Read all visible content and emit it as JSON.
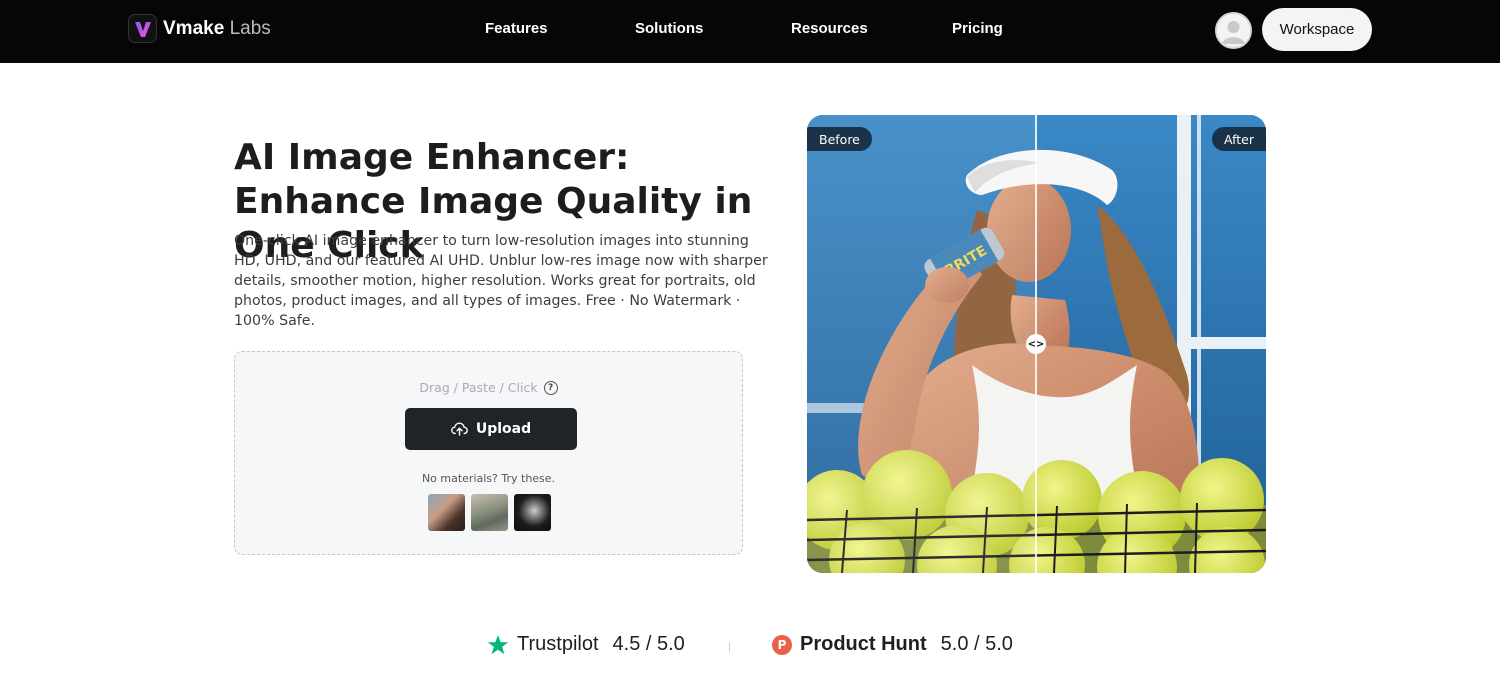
{
  "nav": {
    "logo_brand": "Vmake",
    "logo_suffix": "Labs",
    "links": [
      "Features",
      "Solutions",
      "Resources",
      "Pricing"
    ],
    "workspace_label": "Workspace"
  },
  "hero": {
    "title": "AI Image Enhancer: Enhance Image Quality in One Click",
    "description": "One-click AI image enhancer to turn low-resolution images into stunning HD, UHD, and our featured AI UHD. Unblur low-res image now with sharper details, smoother motion, higher resolution. Works great for portraits, old photos, product images, and all types of images. Free · No Watermark · 100% Safe."
  },
  "upload": {
    "drag_hint": "Drag / Paste / Click",
    "button_label": "Upload",
    "materials_label": "No materials? Try these."
  },
  "compare": {
    "before_label": "Before",
    "after_label": "After",
    "handle_glyph": "<>"
  },
  "ratings": [
    {
      "name": "Trustpilot",
      "score": "4.5 / 5.0"
    },
    {
      "name": "Product Hunt",
      "score": "5.0 / 5.0",
      "icon_letter": "P"
    }
  ],
  "colors": {
    "nav_bg": "#060606",
    "upload_button": "#212427",
    "trustpilot_green": "#00b67a",
    "producthunt_orange": "#e8624a",
    "court_blue": "#2b6fa8"
  }
}
